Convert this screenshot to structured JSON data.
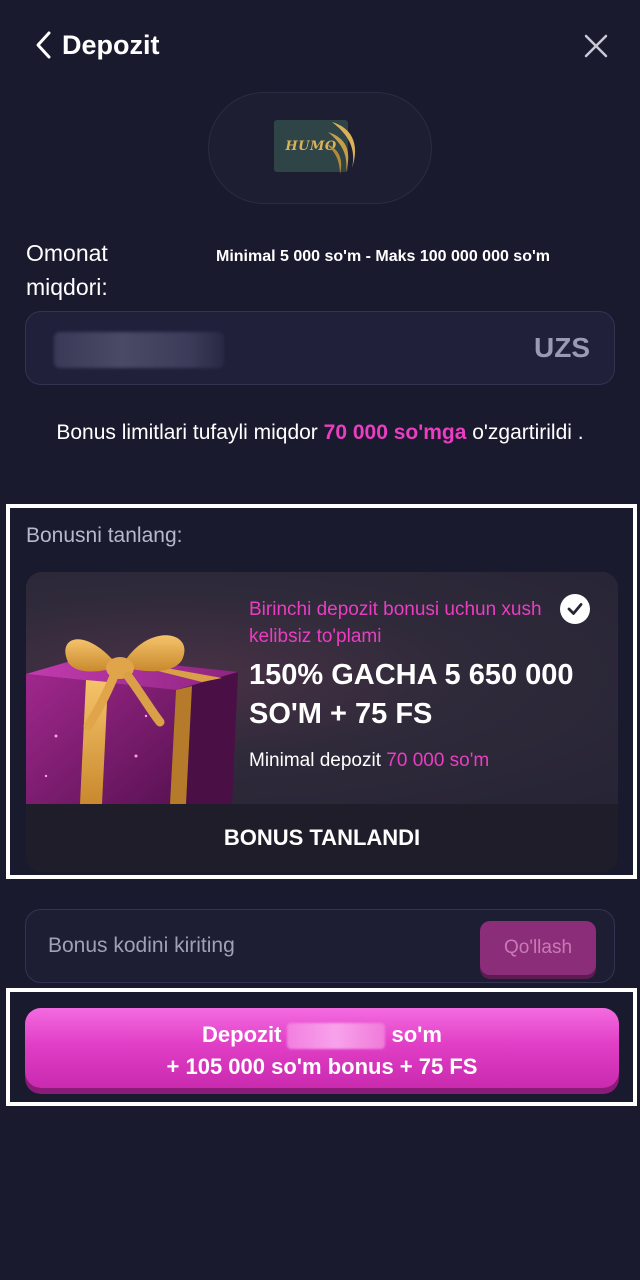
{
  "header": {
    "title": "Depozit",
    "back_icon": "chevron-left-icon",
    "close_icon": "close-icon"
  },
  "payment_method": {
    "logo_text": "HUMO"
  },
  "amount": {
    "label": "Omonat miqdori:",
    "limits": "Minimal 5 000 so'm - Maks 100 000 000 so'm",
    "currency": "UZS"
  },
  "notice": {
    "text_before": "Bonus limitlari tufayli miqdor ",
    "highlight": "70 000 so'mga",
    "text_after": " o'zgartirildi ."
  },
  "bonus": {
    "section_label": "Bonusni tanlang:",
    "subtitle": "Birinchi depozit bonusi uchun xush kelibsiz to'plami",
    "headline": "150% GACHA 5 650 000 SO'M + 75 FS",
    "min_deposit_label": "Minimal depozit ",
    "min_deposit_value": "70 000 so'm",
    "selected_label": "BONUS TANLANDI",
    "selected": true
  },
  "promo": {
    "placeholder": "Bonus kodini kiriting",
    "apply_label": "Qo'llash"
  },
  "deposit_button": {
    "line1_prefix": "Depozit",
    "line1_suffix": "so'm",
    "line2": "+ 105 000 so'm bonus + 75 FS"
  },
  "colors": {
    "background": "#1a1a2e",
    "accent": "#ea3dc2",
    "humo_gold": "#d9b25a"
  }
}
